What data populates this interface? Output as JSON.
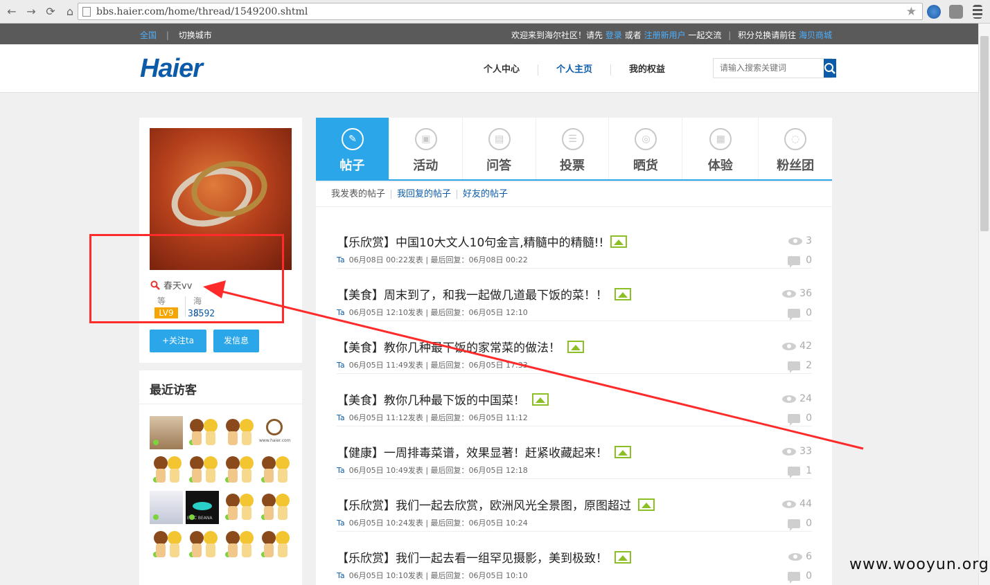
{
  "browser": {
    "url": "bbs.haier.com/home/thread/1549200.shtml"
  },
  "topbar": {
    "city_current": "全国",
    "city_switch": "切换城市",
    "welcome": "欢迎来到海尔社区！请先",
    "login": "登录",
    "or": "或者",
    "register": "注册新用户",
    "join": "一起交流",
    "points": "积分兑换请前往",
    "mall": "海贝商城"
  },
  "header": {
    "logo": "Haier",
    "nav": [
      "个人中心",
      "个人主页",
      "我的权益"
    ],
    "search_placeholder": "请输入搜索关键词"
  },
  "profile": {
    "username": "春天vv",
    "level_label": "等级",
    "level": "LV9",
    "haibei_label": "海贝",
    "haibei": "38592",
    "follow_button": "+关注ta",
    "message_button": "发信息"
  },
  "visitors": {
    "title": "最近访客",
    "logo_text": "www.haier.com",
    "dark_text": "ERIC BEANA"
  },
  "tabs": [
    {
      "label": "帖子",
      "icon": "edit-icon"
    },
    {
      "label": "活动",
      "icon": "gift-icon"
    },
    {
      "label": "问答",
      "icon": "clipboard-icon"
    },
    {
      "label": "投票",
      "icon": "list-icon"
    },
    {
      "label": "晒货",
      "icon": "camera-icon"
    },
    {
      "label": "体验",
      "icon": "grid-icon"
    },
    {
      "label": "粉丝团",
      "icon": "chat-icon"
    }
  ],
  "subtabs": [
    "我发表的帖子",
    "我回复的帖子",
    "好友的帖子"
  ],
  "posts": [
    {
      "title": "【乐欣赏】中国10大文人10句金言,精髓中的精髓!!",
      "author": "Ta",
      "meta": "06月08日 00:22发表 | 最后回复：06月08日 00:22",
      "views": "3",
      "replies": "0"
    },
    {
      "title": "【美食】周末到了，和我一起做几道最下饭的菜！！",
      "author": "Ta",
      "meta": "06月05日 12:10发表 | 最后回复：06月05日 12:10",
      "views": "36",
      "replies": "0"
    },
    {
      "title": "【美食】教你几种最下饭的家常菜的做法！",
      "author": "Ta",
      "meta": "06月05日 11:49发表 | 最后回复：06月05日 17:33",
      "views": "42",
      "replies": "2"
    },
    {
      "title": "【美食】教你几种最下饭的中国菜！",
      "author": "Ta",
      "meta": "06月05日 11:12发表 | 最后回复：06月05日 11:12",
      "views": "24",
      "replies": "0"
    },
    {
      "title": "【健康】一周排毒菜谱，效果显著！赶紧收藏起来！",
      "author": "Ta",
      "meta": "06月05日 10:49发表 | 最后回复：06月05日 12:18",
      "views": "33",
      "replies": "1"
    },
    {
      "title": "【乐欣赏】我们一起去欣赏，欧洲风光全景图，原图超过",
      "author": "Ta",
      "meta": "06月05日 10:24发表 | 最后回复：06月05日 10:24",
      "views": "44",
      "replies": "0"
    },
    {
      "title": "【乐欣赏】我们一起去看一组罕见摄影，美到极致！",
      "author": "Ta",
      "meta": "06月05日 10:10发表 | 最后回复：06月05日 10:10",
      "views": "6",
      "replies": "0"
    }
  ],
  "watermark": "www.wooyun.org",
  "colors": {
    "accent": "#2ba6e8",
    "brand": "#0b5ba8",
    "annotation": "#ff2a2a"
  }
}
